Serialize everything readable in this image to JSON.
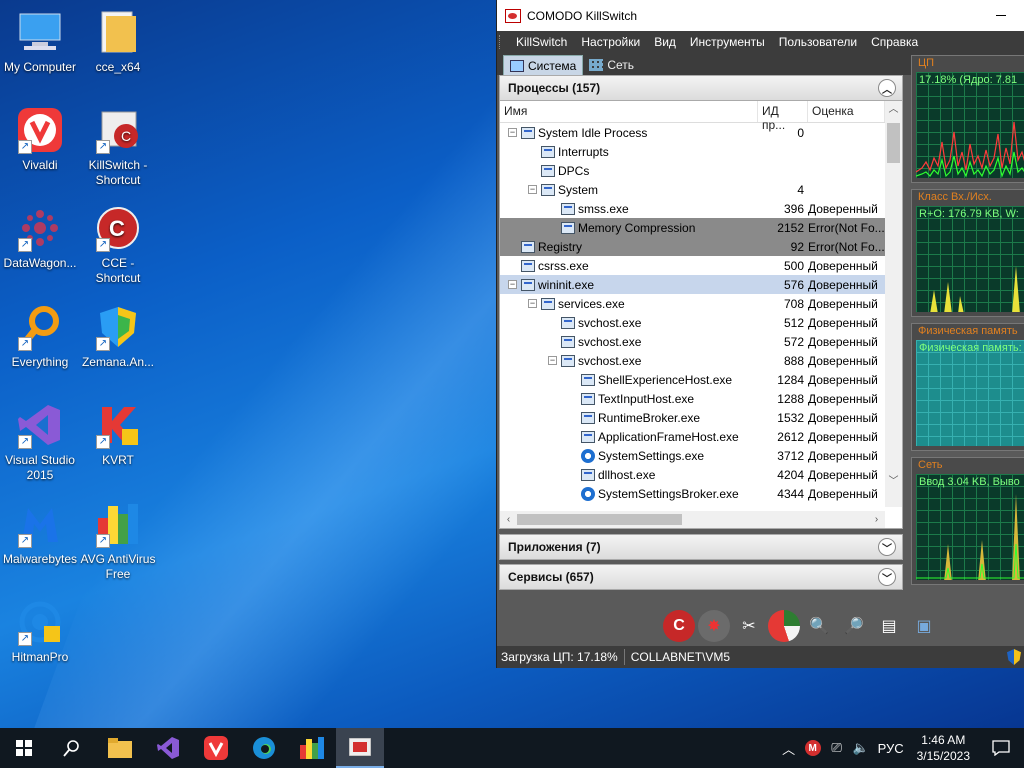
{
  "desktop": {
    "icons": [
      {
        "label": "My Computer",
        "icon": "computer-icon"
      },
      {
        "label": "cce_x64",
        "icon": "folder-icon"
      },
      {
        "label": "Vivaldi",
        "icon": "vivaldi-icon"
      },
      {
        "label": "KillSwitch - Shortcut",
        "icon": "killswitch-icon"
      },
      {
        "label": "DataWagon...",
        "icon": "datawagon-icon"
      },
      {
        "label": "CCE - Shortcut",
        "icon": "comodo-icon"
      },
      {
        "label": "Everything",
        "icon": "search-magnifier-icon"
      },
      {
        "label": "Zemana.An...",
        "icon": "zemana-shield-icon"
      },
      {
        "label": "Visual Studio 2015",
        "icon": "visual-studio-icon"
      },
      {
        "label": "KVRT",
        "icon": "kaspersky-icon"
      },
      {
        "label": "Malwarebytes",
        "icon": "malwarebytes-icon"
      },
      {
        "label": "AVG AntiVirus Free",
        "icon": "avg-icon"
      },
      {
        "label": "HitmanPro",
        "icon": "hitmanpro-icon"
      }
    ]
  },
  "window": {
    "title": "COMODO KillSwitch",
    "menu": [
      "KillSwitch",
      "Настройки",
      "Вид",
      "Инструменты",
      "Пользователи",
      "Справка"
    ],
    "tabs": [
      {
        "label": "Система",
        "active": true
      },
      {
        "label": "Сеть",
        "active": false
      }
    ],
    "processes_header": "Процессы (157)",
    "columns": {
      "name": "Имя",
      "pid": "ИД пр...",
      "rating": "Оценка"
    },
    "rows": [
      {
        "name": "System Idle Process",
        "pid": "0",
        "rating": "",
        "level": 0,
        "expander": "−",
        "icon": "process"
      },
      {
        "name": "Interrupts",
        "pid": "",
        "rating": "",
        "level": 1,
        "expander": "",
        "icon": "process"
      },
      {
        "name": "DPCs",
        "pid": "",
        "rating": "",
        "level": 1,
        "expander": "",
        "icon": "process"
      },
      {
        "name": "System",
        "pid": "4",
        "rating": "",
        "level": 1,
        "expander": "−",
        "icon": "process"
      },
      {
        "name": "smss.exe",
        "pid": "396",
        "rating": "Доверенный",
        "level": 2,
        "expander": "",
        "icon": "process"
      },
      {
        "name": "Memory Compression",
        "pid": "2152",
        "rating": "Error(Not Fo...",
        "level": 2,
        "expander": "",
        "icon": "process",
        "style": "dark"
      },
      {
        "name": "Registry",
        "pid": "92",
        "rating": "Error(Not Fo...",
        "level": 0,
        "expander": "",
        "icon": "process",
        "style": "dark"
      },
      {
        "name": "csrss.exe",
        "pid": "500",
        "rating": "Доверенный",
        "level": 0,
        "expander": "",
        "icon": "process"
      },
      {
        "name": "wininit.exe",
        "pid": "576",
        "rating": "Доверенный",
        "level": 0,
        "expander": "−",
        "icon": "process",
        "style": "sel"
      },
      {
        "name": "services.exe",
        "pid": "708",
        "rating": "Доверенный",
        "level": 1,
        "expander": "−",
        "icon": "process"
      },
      {
        "name": "svchost.exe",
        "pid": "512",
        "rating": "Доверенный",
        "level": 2,
        "expander": "",
        "icon": "process"
      },
      {
        "name": "svchost.exe",
        "pid": "572",
        "rating": "Доверенный",
        "level": 2,
        "expander": "",
        "icon": "process"
      },
      {
        "name": "svchost.exe",
        "pid": "888",
        "rating": "Доверенный",
        "level": 2,
        "expander": "−",
        "icon": "process"
      },
      {
        "name": "ShellExperienceHost.exe",
        "pid": "1284",
        "rating": "Доверенный",
        "level": 3,
        "expander": "",
        "icon": "process"
      },
      {
        "name": "TextInputHost.exe",
        "pid": "1288",
        "rating": "Доверенный",
        "level": 3,
        "expander": "",
        "icon": "process"
      },
      {
        "name": "RuntimeBroker.exe",
        "pid": "1532",
        "rating": "Доверенный",
        "level": 3,
        "expander": "",
        "icon": "process"
      },
      {
        "name": "ApplicationFrameHost.exe",
        "pid": "2612",
        "rating": "Доверенный",
        "level": 3,
        "expander": "",
        "icon": "process"
      },
      {
        "name": "SystemSettings.exe",
        "pid": "3712",
        "rating": "Доверенный",
        "level": 3,
        "expander": "",
        "icon": "gear"
      },
      {
        "name": "dllhost.exe",
        "pid": "4204",
        "rating": "Доверенный",
        "level": 3,
        "expander": "",
        "icon": "process"
      },
      {
        "name": "SystemSettingsBroker.exe",
        "pid": "4344",
        "rating": "Доверенный",
        "level": 3,
        "expander": "",
        "icon": "gear"
      }
    ],
    "apps_header": "Приложения (7)",
    "services_header": "Сервисы (657)",
    "graphs": {
      "cpu": {
        "title": "ЦП",
        "label": "17.18% (Ядро: 7.81"
      },
      "io": {
        "title": "Класс Вх./Исх.",
        "label": "R+O: 176.79 KB, W:"
      },
      "memory": {
        "title": "Физическая память",
        "label": "Физическая память:"
      },
      "network": {
        "title": "Сеть",
        "label": "Ввод 3.04 KB, Выво"
      }
    },
    "status": {
      "cpu_load": "Загрузка ЦП: 17.18%",
      "user": "COLLABNET\\VM5"
    }
  },
  "taskbar": {
    "items": [
      "start-icon",
      "search-icon",
      "file-explorer-icon",
      "visual-studio-icon",
      "vivaldi-icon",
      "edge-icon",
      "avg-icon",
      "killswitch-icon"
    ],
    "language": "РУС",
    "time": "1:46 AM",
    "date": "3/15/2023"
  }
}
